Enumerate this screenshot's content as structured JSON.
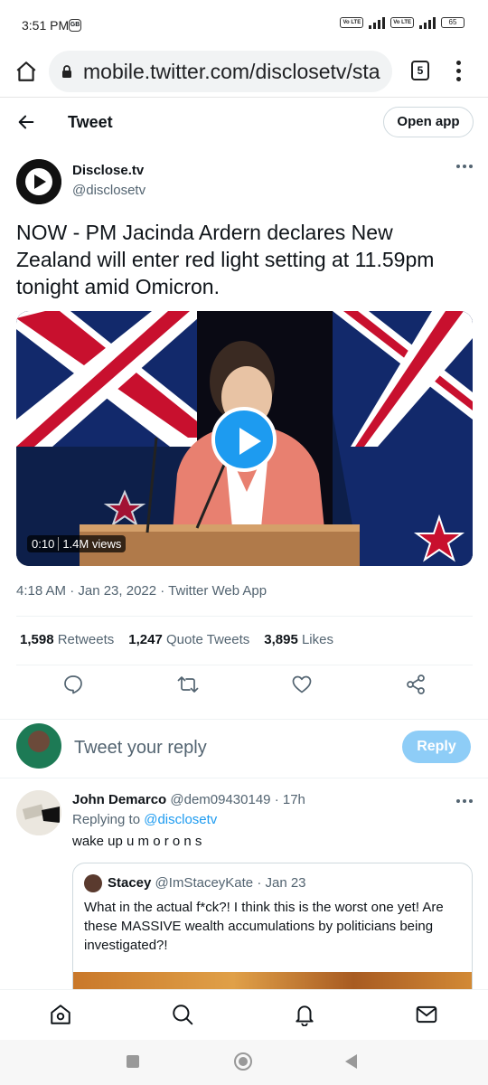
{
  "status_bar": {
    "time": "3:51 PM",
    "data_badge": "GB",
    "network": "4G",
    "battery": "65"
  },
  "browser": {
    "url": "mobile.twitter.com/disclosetv/sta",
    "tab_count": "5"
  },
  "header": {
    "title": "Tweet",
    "open_app": "Open app"
  },
  "tweet": {
    "author_name": "Disclose.tv",
    "author_handle": "@disclosetv",
    "text": "NOW - PM Jacinda Ardern declares New Zealand will enter red light setting at 11.59pm tonight amid Omicron.",
    "video_time": "0:10",
    "video_views": "1.4M views",
    "meta": "4:18 AM · Jan 23, 2022 · Twitter Web App",
    "retweets": "1,598",
    "retweets_label": "Retweets",
    "quotes": "1,247",
    "quotes_label": "Quote Tweets",
    "likes": "3,895",
    "likes_label": "Likes"
  },
  "reply_box": {
    "placeholder": "Tweet your reply",
    "button": "Reply"
  },
  "reply": {
    "name": "John Demarco",
    "handle": "@dem09430149",
    "time": "· 17h",
    "replying_to_label": "Replying to",
    "replying_to": "@disclosetv",
    "text": "wake up u m o r o n s",
    "quote": {
      "name": "Stacey",
      "handle": "@ImStaceyKate",
      "time": "· Jan 23",
      "text": "What in the actual f*ck?! I think this is the worst one yet! Are these MASSIVE wealth accumulations by politicians being investigated?!"
    }
  },
  "icons": {
    "home": "home-icon",
    "search": "search-icon",
    "notifications": "bell-icon",
    "messages": "mail-icon",
    "reply": "reply-icon",
    "retweet": "retweet-icon",
    "like": "heart-icon",
    "share": "share-icon"
  },
  "colors": {
    "accent": "#1d9bf0",
    "reply_button_disabled": "#8ecdf7",
    "secondary_text": "#536471"
  }
}
